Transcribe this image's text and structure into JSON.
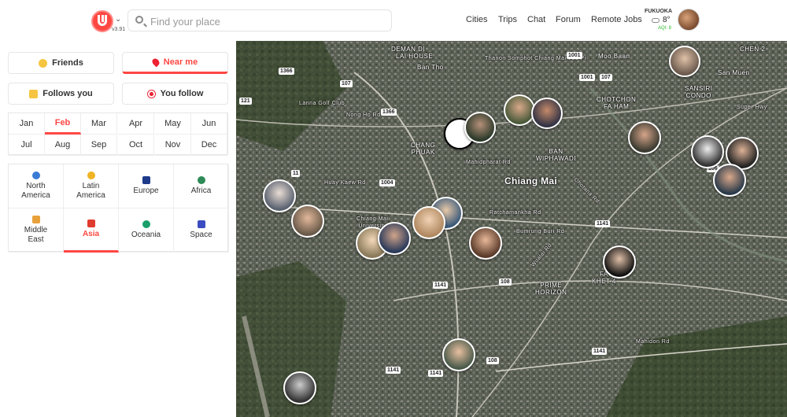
{
  "header": {
    "version": "v3.91",
    "search_placeholder": "Find your place",
    "nav": [
      "Cities",
      "Trips",
      "Chat",
      "Forum",
      "Remote Jobs"
    ],
    "weather": {
      "city": "FUKUOKA",
      "temp": "8°",
      "aqi": "AQI: 8"
    }
  },
  "filters": {
    "friends": "Friends",
    "near_me": "Near me",
    "follows_you": "Follows you",
    "you_follow": "You follow"
  },
  "months": [
    "Jan",
    "Feb",
    "Mar",
    "Apr",
    "May",
    "Jun",
    "Jul",
    "Aug",
    "Sep",
    "Oct",
    "Nov",
    "Dec"
  ],
  "active_month": "Feb",
  "regions": [
    {
      "label": "North America",
      "color": "#3a7bd5"
    },
    {
      "label": "Latin America",
      "color": "#f0b323"
    },
    {
      "label": "Europe",
      "color": "#1e3a8a"
    },
    {
      "label": "Africa",
      "color": "#2e8b57"
    },
    {
      "label": "Middle East",
      "color": "#e8a13a"
    },
    {
      "label": "Asia",
      "color": "#e03b2f"
    },
    {
      "label": "Oceania",
      "color": "#1a9f6a"
    },
    {
      "label": "Space",
      "color": "#3b4cc0"
    }
  ],
  "active_region": "Asia",
  "map": {
    "labels": {
      "lai_house": "LAI HOUSE",
      "bann_di": "DEMAN DI",
      "ban_tho": "Ban Tho",
      "thanon": "Thanon Somphot Chiang Mai 700 Pi",
      "moo_baan": "Moo Baan",
      "lanna_golf": "Lanna Golf Club",
      "nong_ho": "Nong Ho Rd",
      "chang_phuak": "CHANG\nPHUAK",
      "mahidpharat": "Mahidpharat Rd",
      "ban_wiphawadi": "BAN\nWIPHAWADI",
      "chiang_mai": "Chiang Mai",
      "chotana": "Chotana Rd",
      "huay_kaew": "Huay Kaew Rd",
      "chiang_mai_university": "Chiang Mai\nUniversity",
      "ratchamankha": "Ratchamankha Rd",
      "bumrung_buri": "Bumrung Buri Rd",
      "wualai": "Wualai Rd",
      "prime_horizon": "PRIME\nHORIZON",
      "fa_khet": "FA\nKHET 4",
      "mahidon": "Mahidon Rd",
      "sansiri": "SANSIRI\nCONDO",
      "chotchon": "CHOTCHON\nFA HAM",
      "sun_muen": "San Muen",
      "super_hwy": "Super Hwy",
      "chen": "CHEN 2"
    },
    "shields": [
      "121",
      "1366",
      "1366",
      "107",
      "11",
      "1004",
      "1001",
      "1141",
      "108",
      "1141",
      "1141",
      "1141",
      "108",
      "107",
      "1001",
      "1141",
      "106",
      "1366"
    ]
  }
}
